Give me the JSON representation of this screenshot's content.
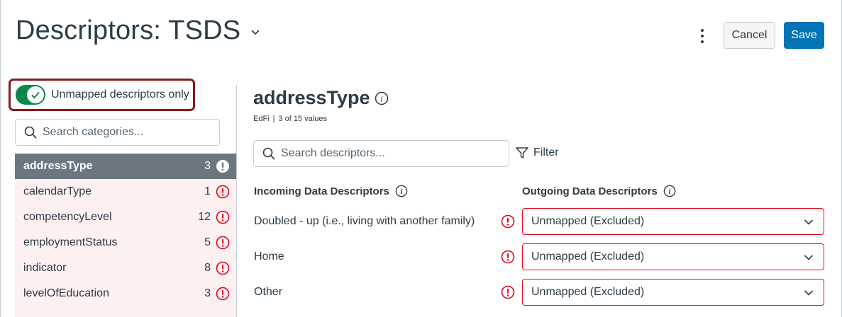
{
  "header": {
    "title": "Descriptors: TSDS",
    "cancel_label": "Cancel",
    "save_label": "Save"
  },
  "sidebar": {
    "toggle_label": "Unmapped descriptors only",
    "toggle_on": true,
    "search_placeholder": "Search categories...",
    "categories": [
      {
        "label": "addressType",
        "count": "3",
        "active": true
      },
      {
        "label": "calendarType",
        "count": "1",
        "active": false
      },
      {
        "label": "competencyLevel",
        "count": "12",
        "active": false
      },
      {
        "label": "employmentStatus",
        "count": "5",
        "active": false
      },
      {
        "label": "indicator",
        "count": "8",
        "active": false
      },
      {
        "label": "levelOfEducation",
        "count": "3",
        "active": false
      }
    ]
  },
  "main": {
    "title": "addressType",
    "source": "EdFi",
    "value_count": "3 of 15 values",
    "search_placeholder": "Search descriptors...",
    "filter_label": "Filter",
    "incoming_header": "Incoming Data Descriptors",
    "outgoing_header": "Outgoing Data Descriptors",
    "rows": [
      {
        "incoming": "Doubled - up (i.e., living with another family)",
        "outgoing": "Unmapped (Excluded)"
      },
      {
        "incoming": "Home",
        "outgoing": "Unmapped (Excluded)"
      },
      {
        "incoming": "Other",
        "outgoing": "Unmapped (Excluded)"
      }
    ]
  },
  "colors": {
    "accent": "#0374b5",
    "toggle_on": "#0b874b",
    "alert": "#e0061f",
    "highlight_border": "#8b1a1a",
    "active_item": "#6b7780",
    "list_bg": "#fdf0f1"
  },
  "icons": {
    "title_menu": "chevron-down-icon",
    "more": "kebab-icon",
    "toggle": "check-icon",
    "search": "search-icon",
    "alert": "warning-circle-icon",
    "info": "info-icon",
    "filter": "filter-icon",
    "select": "chevron-down-icon"
  }
}
